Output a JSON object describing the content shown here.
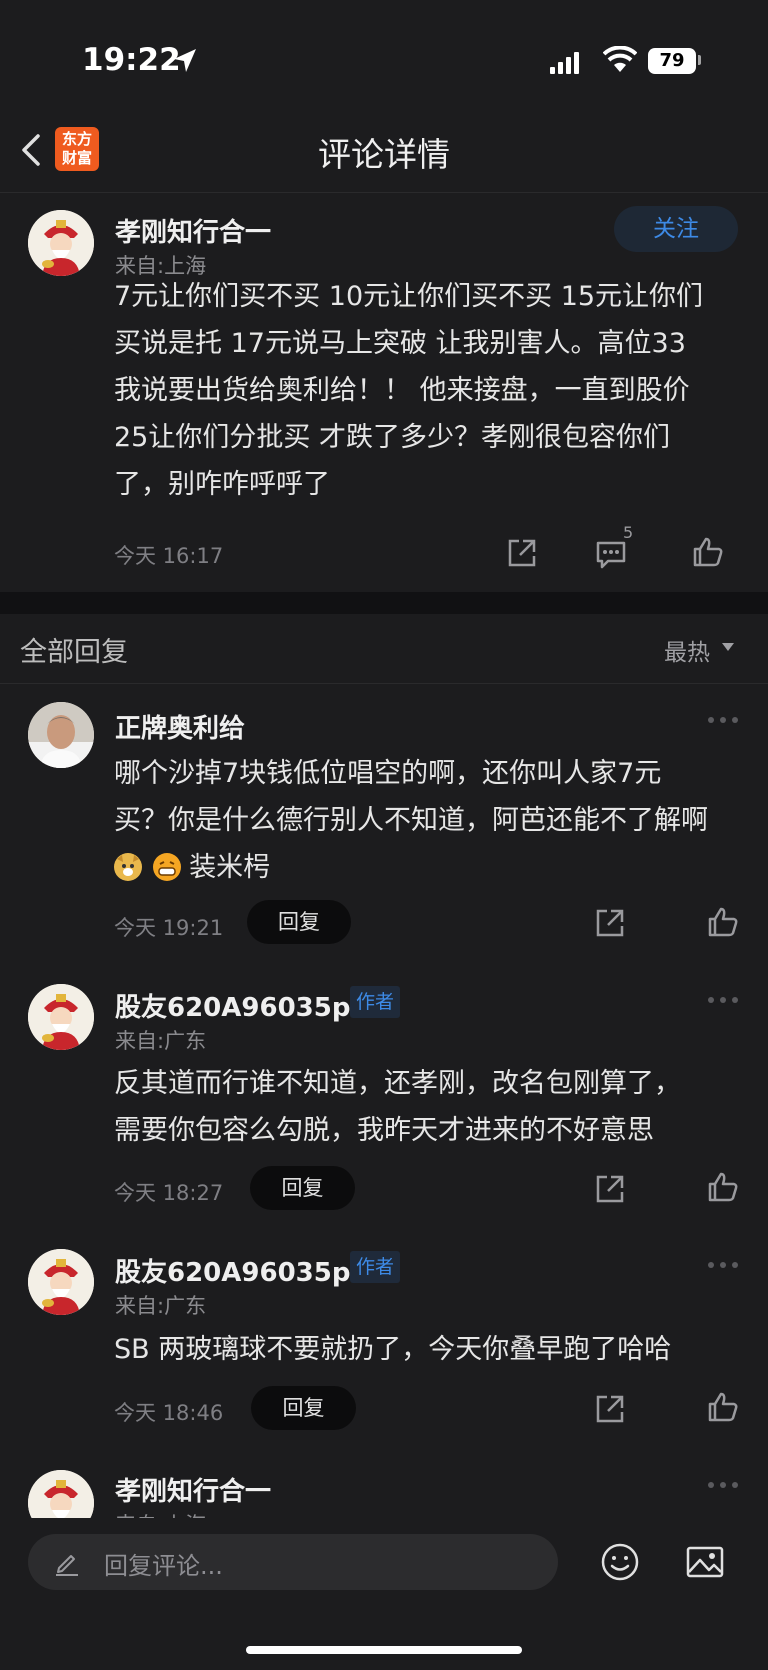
{
  "status_bar": {
    "time": "19:22",
    "battery": "79"
  },
  "nav": {
    "title": "评论详情",
    "logo_line1": "东方",
    "logo_line2": "财富"
  },
  "main_comment": {
    "author": "孝刚知行合一",
    "source": "来自:上海",
    "follow_label": "关注",
    "lines": [
      "7元让你们买不买 10元让你们买不买 15元让你们",
      "买说是托 17元说马上突破 让我别害人。高位33",
      "我说要出货给奥利给！！ 他来接盘，一直到股价",
      " 25让你们分批买 才跌了多少？孝刚很包容你们",
      "了，别咋咋呼呼了"
    ],
    "time": "今天 16:17",
    "comment_count": "5"
  },
  "replies_header": {
    "title": "全部回复",
    "sort": "最热"
  },
  "replies": [
    {
      "author": "正牌奥利给",
      "lines": [
        "哪个沙掉7块钱低位唱空的啊，还你叫人家7元",
        "买？你是什么德行别人不知道，阿芭还能不了解啊"
      ],
      "emoji_tail": "装米枵",
      "time": "今天 19:21",
      "reply_label": "回复"
    },
    {
      "author": "股友620A96035p",
      "tag": "作者",
      "source": "来自:广东",
      "lines": [
        "反其道而行谁不知道，还孝刚，改名包刚算了，",
        "需要你包容么勾脱，我昨天才进来的不好意思"
      ],
      "time": "今天 18:27",
      "reply_label": "回复"
    },
    {
      "author": "股友620A96035p",
      "tag": "作者",
      "source": "来自:广东",
      "lines": [
        "SB 两玻璃球不要就扔了，今天你叠早跑了哈哈"
      ],
      "time": "今天 18:46",
      "reply_label": "回复"
    },
    {
      "author": "孝刚知行合一",
      "source": "来自:上海"
    }
  ],
  "bottom_bar": {
    "placeholder": "回复评论..."
  },
  "colors": {
    "accent": "#3d8ae6",
    "background": "#1c1c1e",
    "logo": "#ef5b1f"
  },
  "icons": [
    "location-arrow-icon",
    "signal-icon",
    "wifi-icon",
    "back-icon",
    "share-icon",
    "comment-icon",
    "like-icon",
    "more-icon",
    "edit-icon",
    "emoji-icon",
    "image-icon"
  ]
}
